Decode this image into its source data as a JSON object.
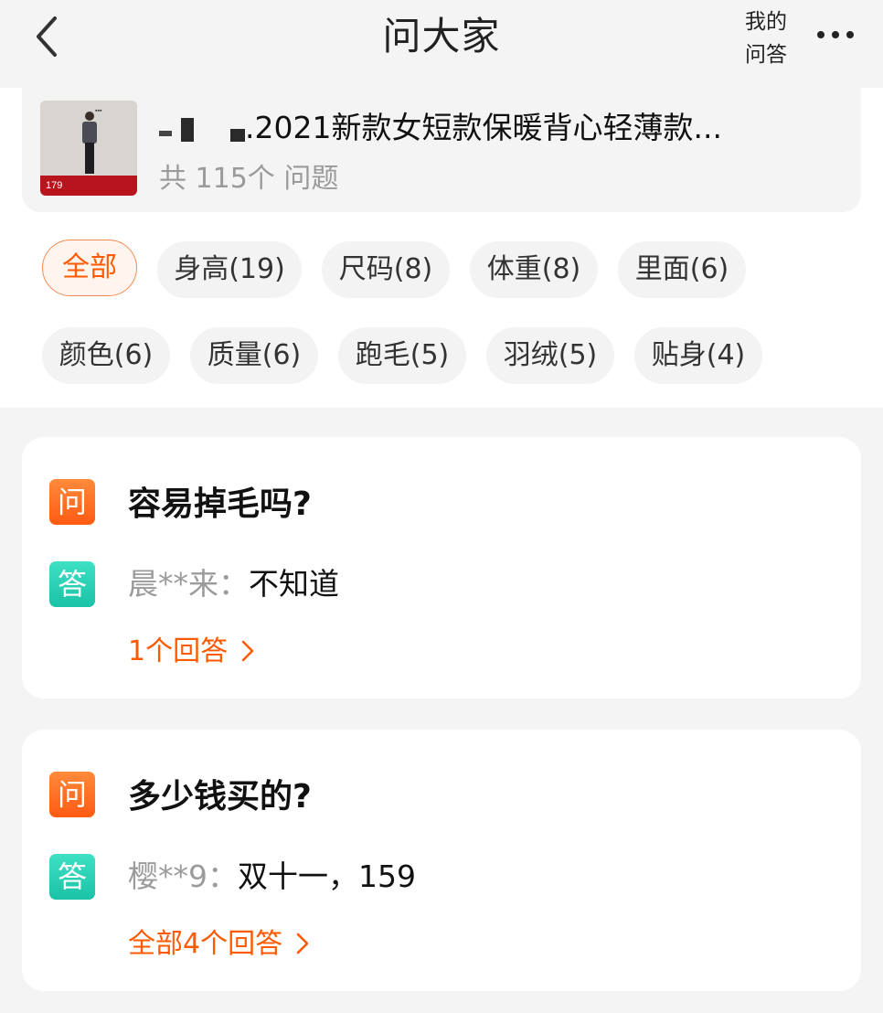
{
  "nav": {
    "title": "问大家",
    "my_qa_line1": "我的",
    "my_qa_line2": "问答"
  },
  "product": {
    "thumb_price": "179",
    "name": ".2021新款女短款保暖背心轻薄款...",
    "count": "共 115个 问题"
  },
  "tags": [
    {
      "label": "全部",
      "active": true
    },
    {
      "label": "身高(19)"
    },
    {
      "label": "尺码(8)"
    },
    {
      "label": "体重(8)"
    },
    {
      "label": "里面(6)"
    },
    {
      "label": "颜色(6)"
    },
    {
      "label": "质量(6)"
    },
    {
      "label": "跑毛(5)"
    },
    {
      "label": "羽绒(5)"
    },
    {
      "label": "贴身(4)"
    }
  ],
  "badges": {
    "question": "问",
    "answer": "答"
  },
  "questions": [
    {
      "question": "容易掉毛吗?",
      "user": "晨**来：",
      "answer": "不知道",
      "more": "1个回答"
    },
    {
      "question": "多少钱买的?",
      "user": "樱**9：",
      "answer": "双十一，159",
      "more": "全部4个回答"
    }
  ],
  "colors": {
    "accent": "#ff5a00",
    "question_badge": "#ff6a1f",
    "answer_badge": "#24c9ad",
    "page_bg": "#f4f4f4"
  }
}
